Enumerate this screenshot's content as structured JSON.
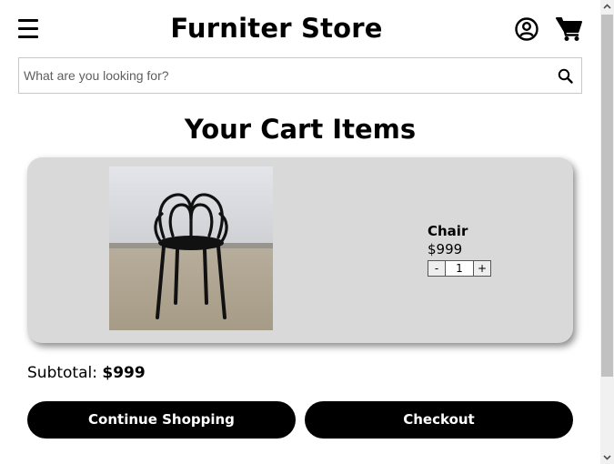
{
  "header": {
    "store_title": "Furniter Store",
    "icons": [
      "menu-icon",
      "user-account-icon",
      "shopping-cart-icon"
    ]
  },
  "search": {
    "placeholder": "What are you looking for?",
    "value": "",
    "icon": "search-icon"
  },
  "cart": {
    "heading": "Your Cart Items",
    "items": [
      {
        "name": "Chair",
        "price": "$999",
        "quantity": "1",
        "decrement_label": "-",
        "increment_label": "+"
      }
    ],
    "subtotal_label": "Subtotal:",
    "subtotal_value": "$999"
  },
  "actions": {
    "continue_label": "Continue Shopping",
    "checkout_label": "Checkout"
  },
  "colors": {
    "card_background": "#d9d9d9",
    "button_background": "#000000",
    "button_text": "#ffffff"
  }
}
